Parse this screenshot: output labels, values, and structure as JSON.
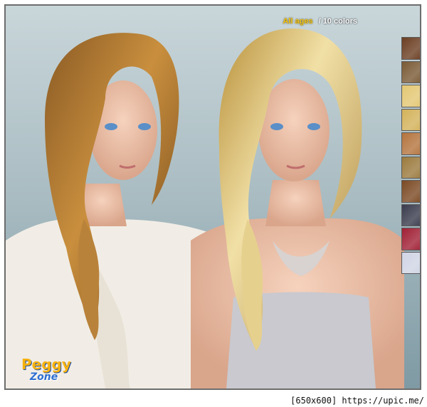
{
  "caption": {
    "ages": "All ages",
    "colors": "/ 10 colors"
  },
  "swatches": [
    "#6b3e22",
    "#7a5a35",
    "#e3c773",
    "#d3b25a",
    "#b4743e",
    "#9b7a3d",
    "#7b4a24",
    "#3a3b4d",
    "#a02035",
    "#d0d4e4"
  ],
  "logo": {
    "line1": "Peggy",
    "line2": "Zone"
  },
  "footer": "[650x600] https://upic.me/"
}
